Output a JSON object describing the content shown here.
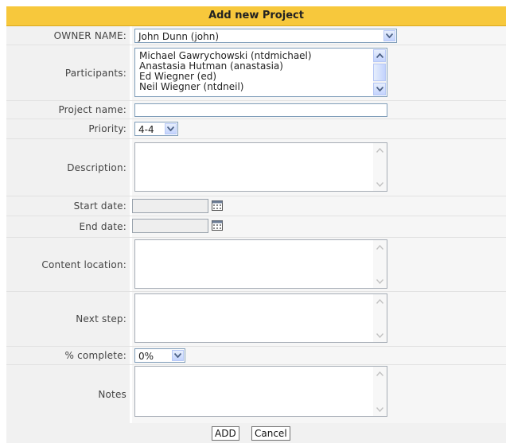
{
  "form": {
    "title": "Add new Project",
    "owner": {
      "label": "OWNER NAME:",
      "value": "John Dunn (john)"
    },
    "participants": {
      "label": "Participants:",
      "options": [
        "Michael Gawrychowski (ntdmichael)",
        "Anastasia Hutman (anastasia)",
        "Ed Wiegner (ed)",
        "Neil Wiegner (ntdneil)"
      ]
    },
    "project_name": {
      "label": "Project name:",
      "value": ""
    },
    "priority": {
      "label": "Priority:",
      "value": "4-4"
    },
    "description": {
      "label": "Description:",
      "value": ""
    },
    "start_date": {
      "label": "Start date:",
      "value": ""
    },
    "end_date": {
      "label": "End date:",
      "value": ""
    },
    "content_location": {
      "label": "Content location:",
      "value": ""
    },
    "next_step": {
      "label": "Next step:",
      "value": ""
    },
    "percent_complete": {
      "label": "% complete:",
      "value": "0%"
    },
    "notes": {
      "label": "Notes",
      "value": ""
    },
    "buttons": {
      "add": "ADD",
      "cancel": "Cancel"
    }
  },
  "colors": {
    "header_bg": "#f7c83c",
    "label_bg": "#f1f1f1",
    "field_border": "#7f9db9"
  },
  "icons": {
    "dropdown": "chevron-down-icon",
    "calendar": "calendar-icon",
    "scroll_up": "scroll-up-icon",
    "scroll_down": "scroll-down-icon"
  }
}
